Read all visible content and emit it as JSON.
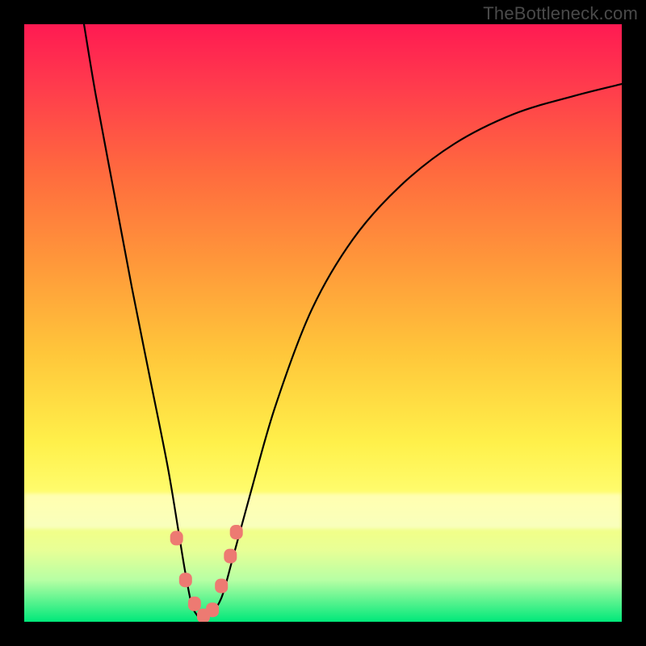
{
  "watermark": "TheBottleneck.com",
  "chart_data": {
    "type": "line",
    "title": "",
    "xlabel": "",
    "ylabel": "",
    "xlim": [
      0,
      100
    ],
    "ylim": [
      0,
      100
    ],
    "series": [
      {
        "name": "bottleneck-curve",
        "x": [
          10,
          12,
          15,
          18,
          21,
          24,
          26,
          27,
          28,
          29,
          30,
          31,
          33,
          35,
          38,
          42,
          48,
          55,
          63,
          72,
          82,
          92,
          100
        ],
        "y": [
          100,
          88,
          72,
          56,
          41,
          26,
          14,
          8,
          3,
          1,
          0.5,
          1,
          4,
          11,
          22,
          36,
          52,
          64,
          73,
          80,
          85,
          88,
          90
        ]
      }
    ],
    "markers": {
      "name": "trough-markers",
      "color": "#ed7a72",
      "points": [
        {
          "x": 25.5,
          "y": 14
        },
        {
          "x": 27.0,
          "y": 7
        },
        {
          "x": 28.5,
          "y": 3
        },
        {
          "x": 30.0,
          "y": 1
        },
        {
          "x": 31.5,
          "y": 2
        },
        {
          "x": 33.0,
          "y": 6
        },
        {
          "x": 34.5,
          "y": 11
        },
        {
          "x": 35.5,
          "y": 15
        }
      ]
    },
    "background_gradient": {
      "top": "#ff1a52",
      "mid": "#ffcc3a",
      "bottom": "#00e87a"
    }
  }
}
